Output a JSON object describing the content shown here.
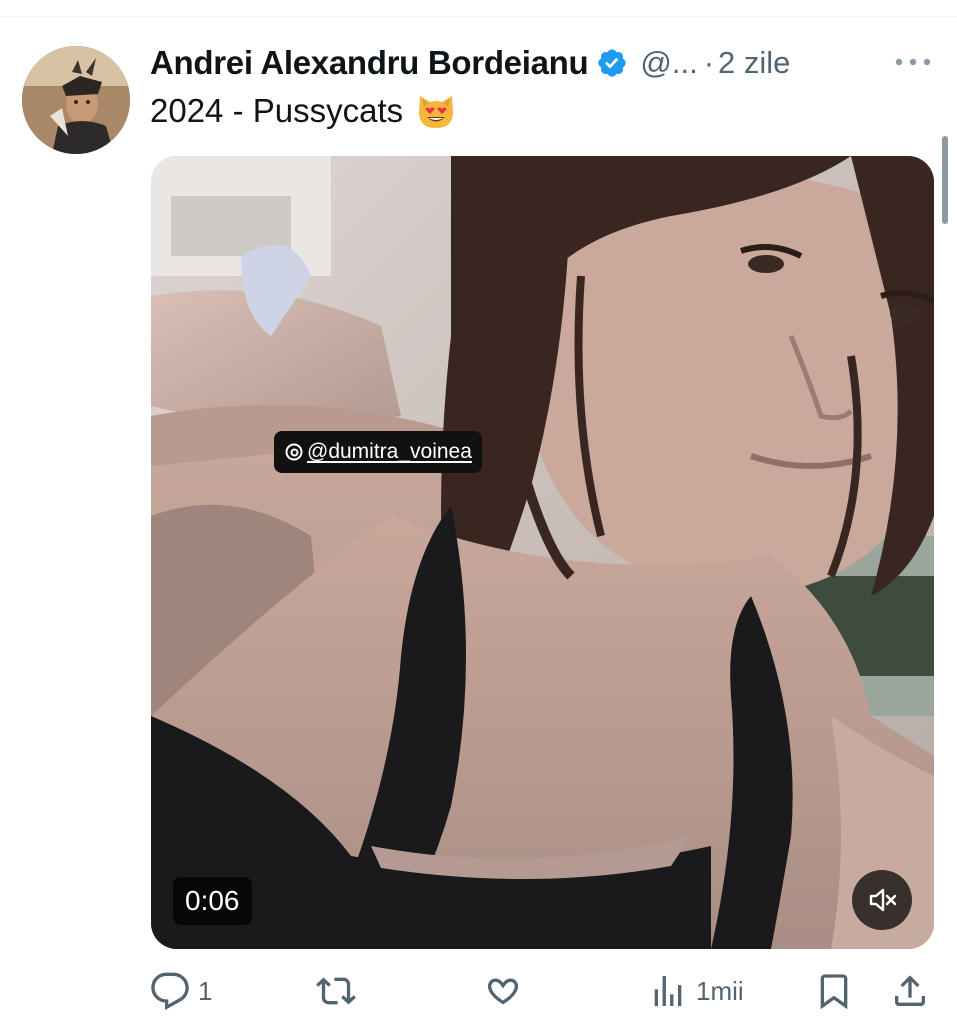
{
  "tweet": {
    "author": {
      "display_name": "Andrei Alexandru Bordeianu",
      "handle": "@...",
      "verified": true,
      "avatar_icon": "avatar-photo"
    },
    "time_separator": "·",
    "time": "2 zile",
    "text": "2024 - Pussycats",
    "emoji": "smiling-cat-heart-eyes-emoji",
    "media": {
      "type": "video",
      "sticker_text": "@dumitra_voinea",
      "duration": "0:06",
      "muted": true
    },
    "stats": {
      "replies": "1",
      "retweets": "",
      "likes": "",
      "views": "1mii"
    }
  },
  "icons": {
    "more": "more-dots-icon",
    "reply": "reply-bubble-icon",
    "retweet": "retweet-icon",
    "like": "heart-icon",
    "views": "analytics-bars-icon",
    "bookmark": "bookmark-icon",
    "share": "share-upload-icon",
    "mute": "speaker-muted-icon",
    "verified": "verified-badge-icon"
  },
  "colors": {
    "text_primary": "#0f1419",
    "text_secondary": "#536471",
    "verified_blue": "#1d9bf0"
  }
}
